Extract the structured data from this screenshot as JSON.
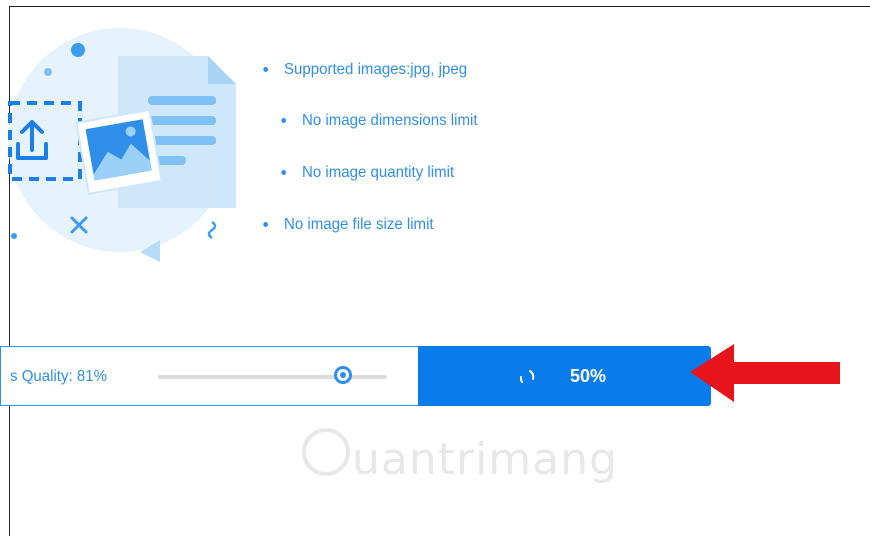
{
  "features": {
    "items": [
      {
        "label": "Supported images:jpg, jpeg"
      },
      {
        "label": "No image dimensions limit"
      },
      {
        "label": "No image quantity limit"
      },
      {
        "label": "No image file size limit"
      }
    ]
  },
  "quality": {
    "label": "s Quality: 81%",
    "value_fraction": 0.81
  },
  "progress": {
    "label": "50%",
    "fraction": 0.5
  },
  "watermark": {
    "text": "uantrimang"
  },
  "colors": {
    "accent": "#2f8fe8",
    "button": "#0a7bea",
    "arrow": "#e8141b",
    "illustration_bg": "#e6f3fc"
  },
  "icons": {
    "upload": "upload-icon",
    "spinner": "loading-spinner-icon",
    "arrow": "red-arrow-icon"
  }
}
